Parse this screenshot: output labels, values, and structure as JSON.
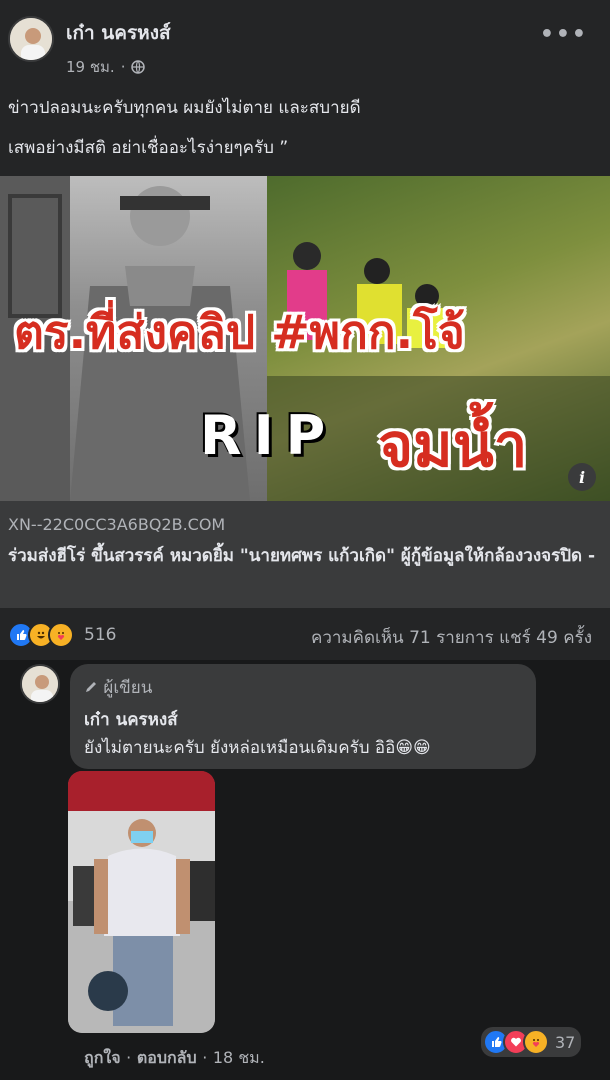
{
  "post": {
    "author": "เก๋า นครหงส์",
    "time": "19 ชม.",
    "dot": "·",
    "line1": "ข่าวปลอมนะครับทุกคน ผมยังไม่ตาย และสบายดี",
    "line2": "เสพอย่างมีสติ อย่าเชื่ออะไรง่ายๆครับ ”",
    "more": "•••"
  },
  "hero": {
    "headline": "ตร.ที่ส่งคลิป #พกก.โจ้",
    "rip": "RIP",
    "subhead": "จมน้ำ",
    "info": "i"
  },
  "link": {
    "domain": "XN--22C0CC3A6BQ2B.COM",
    "title": "ร่วมส่งฮีโร่ ขึ้นสวรรค์ หมวดยิ้ม \"นายทศพร แก้วเกิด\" ผู้กู้ข้อมูลให้กล้องวงจรปิด -"
  },
  "engagement": {
    "reaction_count": "516",
    "stats": "ความคิดเห็น 71 รายการ แชร์ 49 ครั้ง"
  },
  "comment": {
    "badge": "ผู้เขียน",
    "author": "เก๋า นครหงส์",
    "text": "ยังไม่ตายนะครับ ยังหล่อเหมือนเดิมครับ อิอิ😁😁",
    "reaction_count": "37",
    "like": "ถูกใจ",
    "reply": "ตอบกลับ",
    "time": "18 ชม.",
    "sep": "·"
  },
  "colors": {
    "bg": "#18191a",
    "card": "#242526",
    "surface": "#3a3b3c",
    "like_blue": "#2078f4",
    "love_red": "#f33e58",
    "haha_yellow": "#f7b125"
  }
}
